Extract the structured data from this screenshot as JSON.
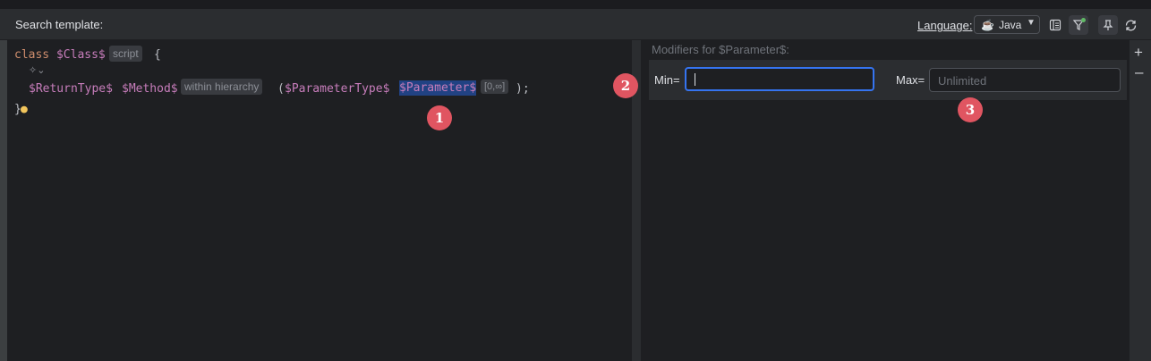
{
  "header": {
    "title": "Search template:",
    "language_label": "Language:",
    "language_value": "Java"
  },
  "icons": {
    "language": "java-cup-icon",
    "chevron": "chevron-down-icon",
    "panel": "panel-icon",
    "filter": "filter-icon",
    "pin": "pin-icon",
    "refresh": "refresh-icon",
    "add": "plus-icon",
    "remove": "minus-icon",
    "gutter": "fold-icon",
    "bulb": "lightbulb-icon"
  },
  "editor": {
    "line1": {
      "kw": "class",
      "var": "$Class$",
      "tag": "script",
      "brace": "{"
    },
    "line3": {
      "ret": "$ReturnType$",
      "method": "$Method$",
      "tag": "within hierarchy",
      "open": "(",
      "ptype": "$ParameterType$",
      "param": "$Parameter$",
      "count": "[0,∞]",
      "close": ");"
    },
    "line4": {
      "brace": "}"
    }
  },
  "modifiers": {
    "title": "Modifiers for $Parameter$:",
    "min_label": "Min=",
    "min_value": "",
    "max_label": "Max=",
    "max_placeholder": "Unlimited"
  },
  "badges": [
    "1",
    "2",
    "3"
  ],
  "colors": {
    "accent": "#3574f0",
    "badge": "#e05561",
    "keyword": "#cf8e6d",
    "variable": "#c77dbb"
  }
}
